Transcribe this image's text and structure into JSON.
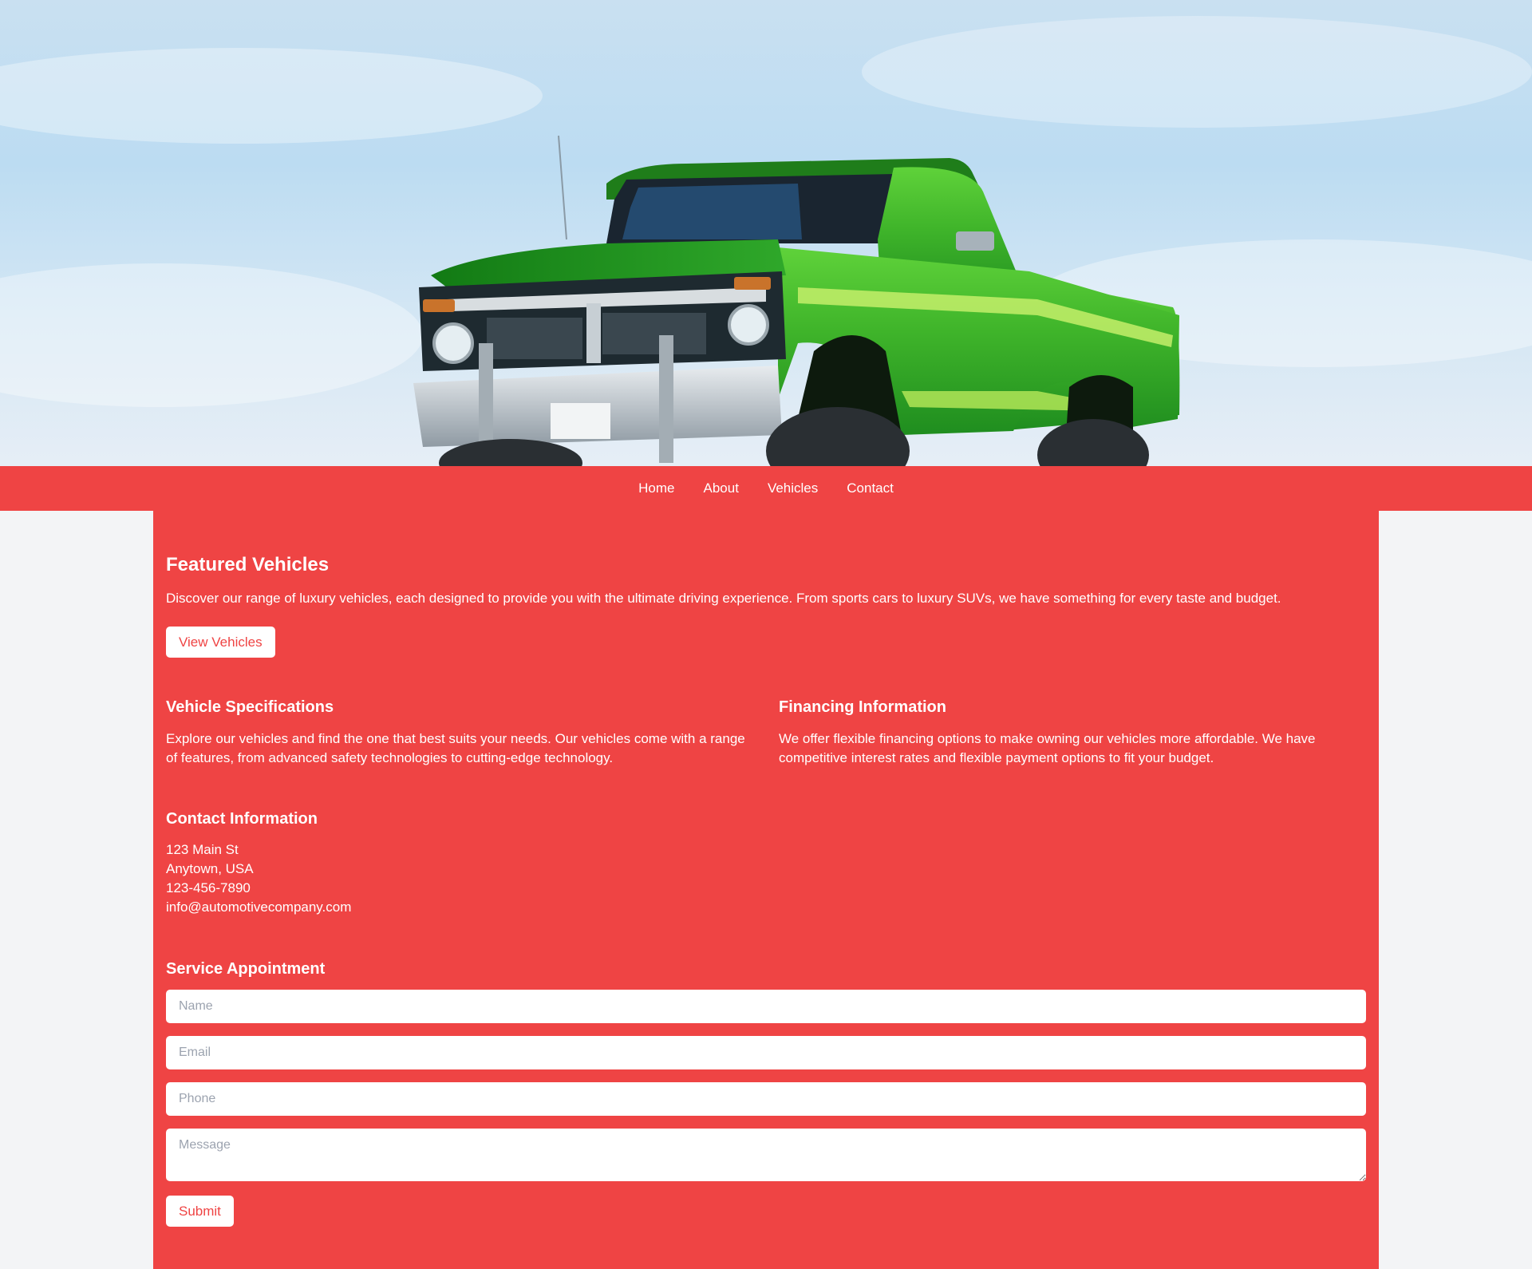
{
  "hero": {
    "image": "green-pickup-truck-hero-image"
  },
  "nav": {
    "items": [
      {
        "label": "Home"
      },
      {
        "label": "About"
      },
      {
        "label": "Vehicles"
      },
      {
        "label": "Contact"
      }
    ]
  },
  "featured": {
    "title": "Featured Vehicles",
    "description": "Discover our range of luxury vehicles, each designed to provide you with the ultimate driving experience. From sports cars to luxury SUVs, we have something for every taste and budget.",
    "button_label": "View Vehicles"
  },
  "specs": {
    "title": "Vehicle Specifications",
    "description": "Explore our vehicles and find the one that best suits your needs. Our vehicles come with a range of features, from advanced safety technologies to cutting-edge technology."
  },
  "financing": {
    "title": "Financing Information",
    "description": "We offer flexible financing options to make owning our vehicles more affordable. We have competitive interest rates and flexible payment options to fit your budget."
  },
  "contact": {
    "title": "Contact Information",
    "address_line1": "123 Main St",
    "address_line2": "Anytown, USA",
    "phone": "123-456-7890",
    "email": "info@automotivecompany.com"
  },
  "appointment": {
    "title": "Service Appointment",
    "name_placeholder": "Name",
    "email_placeholder": "Email",
    "phone_placeholder": "Phone",
    "message_placeholder": "Message",
    "submit_label": "Submit"
  },
  "colors": {
    "accent": "#ef4444",
    "page_background": "#f3f4f6",
    "button_background": "#ffffff"
  }
}
